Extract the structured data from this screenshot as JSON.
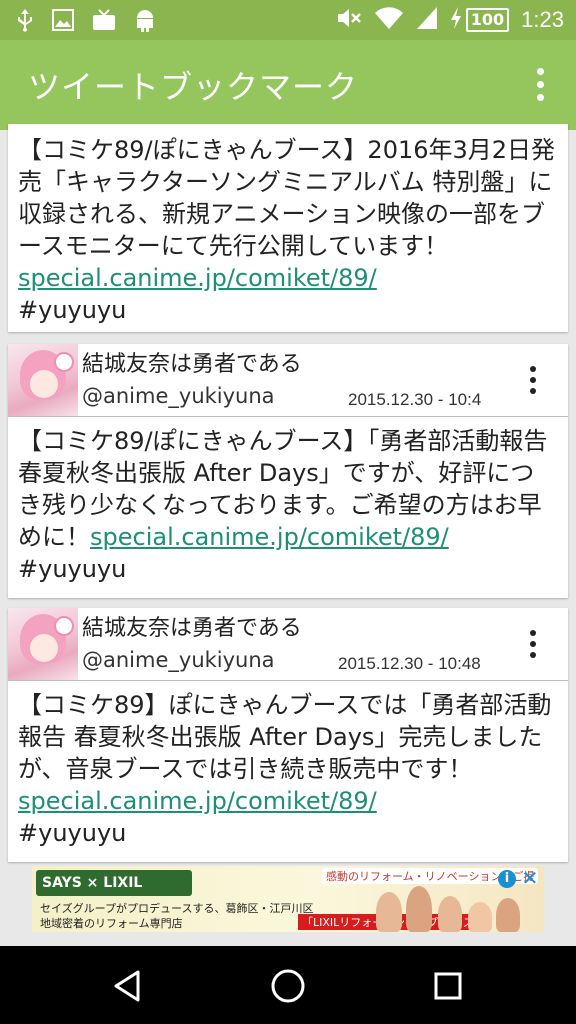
{
  "status_bar": {
    "time": "1:23",
    "battery": "100",
    "left_icons": [
      "usb-icon",
      "image-icon",
      "tv-icon",
      "android-icon"
    ],
    "right_icons": [
      "mute-icon",
      "wifi-icon",
      "signal-icon",
      "charging-icon"
    ]
  },
  "app_bar": {
    "title": "ツイートブックマーク",
    "menu_icon": "overflow-menu-icon",
    "color": "#95c65d"
  },
  "tweets": [
    {
      "text": "【コミケ89/ぽにきゃんブース】2016年3月2日発売「キャラクターソングミニアルバム 特別盤」に収録される、新規アニメーション映像の一部をブースモニターにて先行公開しています！",
      "link": "special.canime.jp/comiket/89/",
      "hashtag": "#yuyuyu"
    },
    {
      "user_name": "結城友奈は勇者である",
      "handle": "@anime_yukiyuna",
      "date": "2015.12.30 - 10:4",
      "text": "【コミケ89/ぽにきゃんブース】「勇者部活動報告 春夏秋冬出張版 After Days」ですが、好評につき残り少なくなっております。ご希望の方はお早めに！",
      "link": "special.canime.jp/comiket/89/",
      "hashtag": "#yuyuyu"
    },
    {
      "user_name": "結城友奈は勇者である",
      "handle": "@anime_yukiyuna",
      "date": "2015.12.30 - 10:48",
      "text": "【コミケ89】ぽにきゃんブースでは「勇者部活動報告 春夏秋冬出張版 After Days」完売しましたが、音泉ブースでは引き続き販売中です！",
      "link": "special.canime.jp/comiket/89/",
      "hashtag": "#yuyuyu"
    }
  ],
  "ad": {
    "logo": "SAYS × LIXIL",
    "line1": "セイズグループがプロデュースする、葛飾区・江戸川区",
    "line2": "地域密着のリフォーム専門店",
    "tag": "「LIXILリフォームショップ セイズ」",
    "badge": "感動のリフォーム・リノベーションをご提",
    "info_icon": "info-icon",
    "close_icon": "close-icon"
  },
  "nav_bar": {
    "icons": [
      "back-icon",
      "home-icon",
      "recents-icon"
    ]
  }
}
